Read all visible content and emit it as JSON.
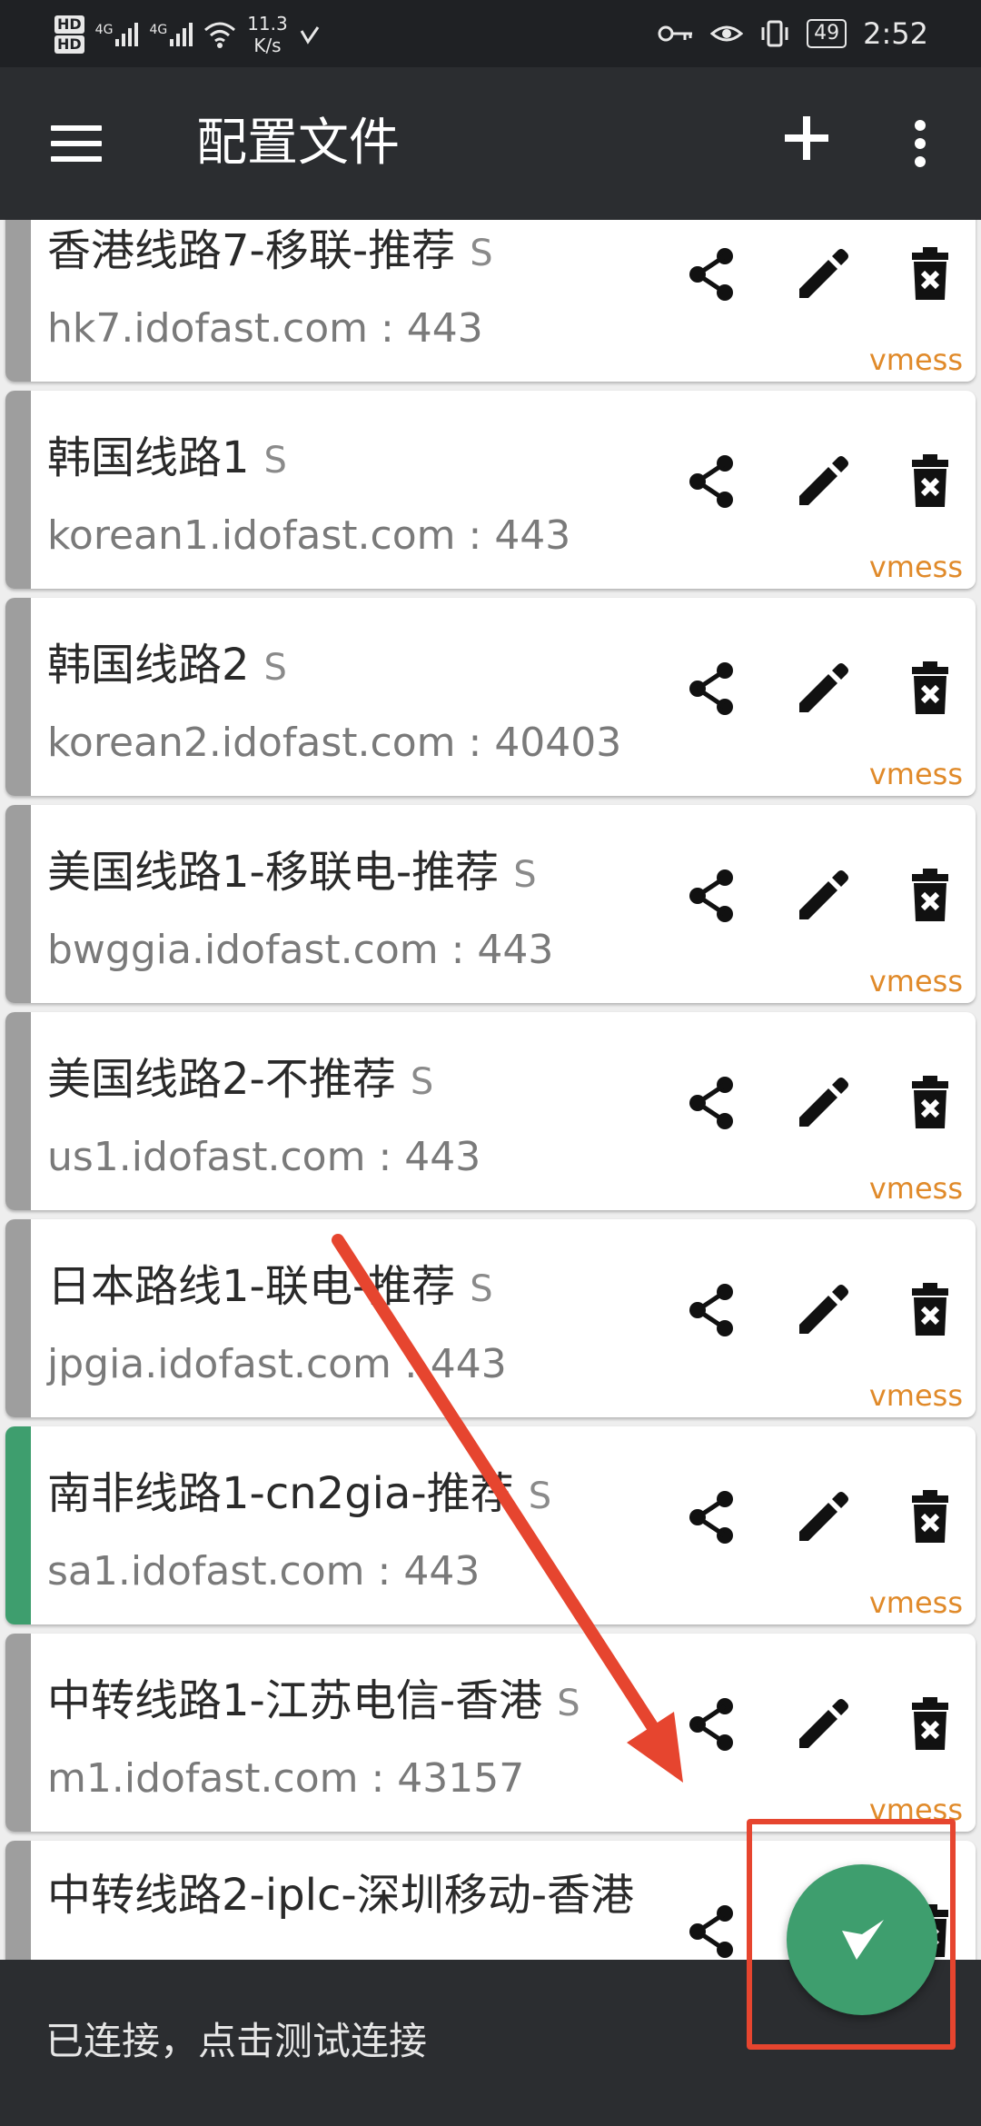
{
  "status_bar": {
    "hd1": "HD",
    "hd2": "HD",
    "net1": "4G",
    "net2": "4G",
    "speed_value": "11.3",
    "speed_unit": "K/s",
    "battery": "49",
    "time": "2:52"
  },
  "app_bar": {
    "title": "配置文件"
  },
  "servers": [
    {
      "name": "香港线路7-移联-推荐",
      "badge": "S",
      "address": "hk7.idofast.com : 443",
      "type": "vmess",
      "active": false
    },
    {
      "name": "韩国线路1",
      "badge": "S",
      "address": "korean1.idofast.com : 443",
      "type": "vmess",
      "active": false
    },
    {
      "name": "韩国线路2",
      "badge": "S",
      "address": "korean2.idofast.com : 40403",
      "type": "vmess",
      "active": false
    },
    {
      "name": "美国线路1-移联电-推荐",
      "badge": "S",
      "address": "bwggia.idofast.com : 443",
      "type": "vmess",
      "active": false
    },
    {
      "name": "美国线路2-不推荐",
      "badge": "S",
      "address": "us1.idofast.com : 443",
      "type": "vmess",
      "active": false
    },
    {
      "name": "日本路线1-联电-推荐",
      "badge": "S",
      "address": "jpgia.idofast.com : 443",
      "type": "vmess",
      "active": false
    },
    {
      "name": "南非线路1-cn2gia-推荐",
      "badge": "S",
      "address": "sa1.idofast.com : 443",
      "type": "vmess",
      "active": true
    },
    {
      "name": "中转线路1-江苏电信-香港",
      "badge": "S",
      "address": "m1.idofast.com : 43157",
      "type": "vmess",
      "active": false
    },
    {
      "name": "中转线路2-iplc-深圳移动-香港",
      "badge": "",
      "address": "",
      "type": "",
      "active": false
    }
  ],
  "bottom_bar": {
    "status_text": "已连接，点击测试连接"
  },
  "colors": {
    "accent_green": "#3e9e6e",
    "inactive_stripe": "#9e9e9e",
    "type_text": "#e08a2a",
    "annotation_red": "#e6452f"
  },
  "icons": {
    "share": "share-icon",
    "edit": "edit-icon",
    "delete": "delete-icon",
    "fab": "v2ray-logo-icon"
  }
}
